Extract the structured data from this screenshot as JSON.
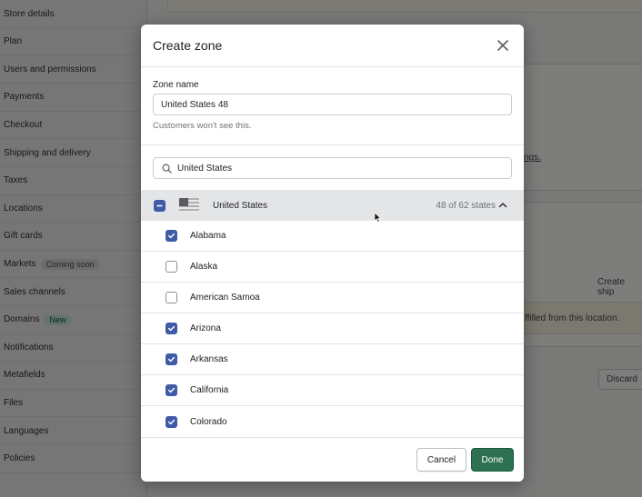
{
  "sidebar": {
    "items": [
      {
        "label": "Store details"
      },
      {
        "label": "Plan"
      },
      {
        "label": "Users and permissions"
      },
      {
        "label": "Payments"
      },
      {
        "label": "Checkout"
      },
      {
        "label": "Shipping and delivery"
      },
      {
        "label": "Taxes"
      },
      {
        "label": "Locations"
      },
      {
        "label": "Gift cards"
      },
      {
        "label": "Markets",
        "badge": "Coming soon"
      },
      {
        "label": "Sales channels"
      },
      {
        "label": "Domains",
        "badge": "New"
      },
      {
        "label": "Notifications"
      },
      {
        "label": "Metafields"
      },
      {
        "label": "Files"
      },
      {
        "label": "Languages"
      },
      {
        "label": "Policies"
      }
    ]
  },
  "background": {
    "link_fragment": "ngs.",
    "create_shipping_fragment": "Create ship",
    "fulfilled_notice": "ffilled from this location.",
    "discard_fragment": "Discard"
  },
  "modal": {
    "title": "Create zone",
    "close_icon": "close-icon",
    "zone_name_label": "Zone name",
    "zone_name_value": "United States 48",
    "help_text": "Customers won't see this.",
    "search_icon": "search-icon",
    "search_value": "United States",
    "country": {
      "name": "United States",
      "count_text": "48 of 62 states",
      "checkbox_state": "indeterminate",
      "expanded": true
    },
    "states": [
      {
        "name": "Alabama",
        "checked": true
      },
      {
        "name": "Alaska",
        "checked": false
      },
      {
        "name": "American Samoa",
        "checked": false
      },
      {
        "name": "Arizona",
        "checked": true
      },
      {
        "name": "Arkansas",
        "checked": true
      },
      {
        "name": "California",
        "checked": true
      },
      {
        "name": "Colorado",
        "checked": true
      }
    ],
    "cancel_label": "Cancel",
    "done_label": "Done"
  },
  "colors": {
    "accent_checkbox": "#3f5aa6",
    "primary_button": "#2e7152"
  }
}
